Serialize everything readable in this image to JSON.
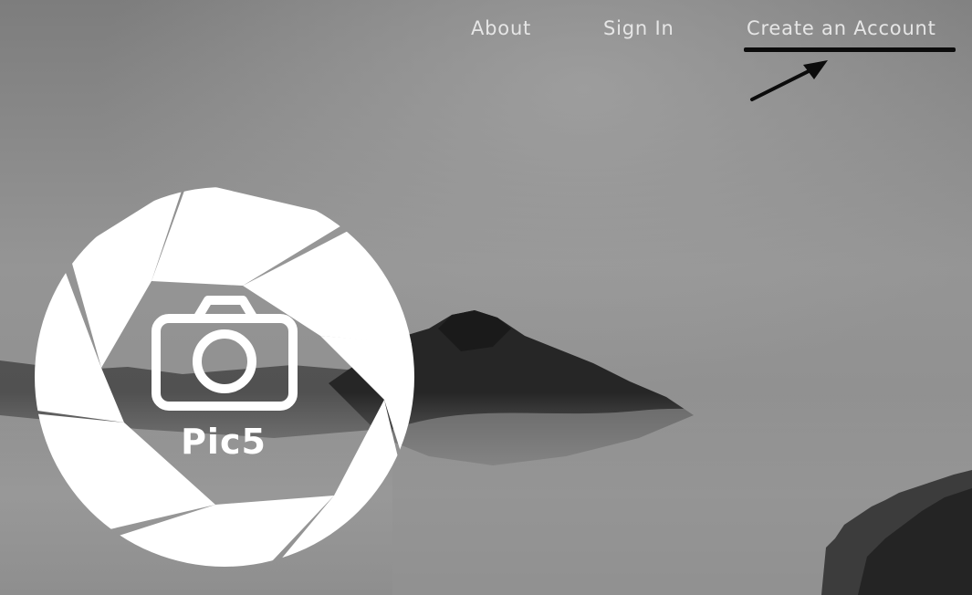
{
  "nav": {
    "about_label": "About",
    "signin_label": "Sign In",
    "create_label": "Create an Account"
  },
  "logo": {
    "brand_text": "Pic5"
  },
  "colors": {
    "nav_text": "#e6e6e6",
    "logo_fill": "#ffffff",
    "underline": "#0c0c0c",
    "background": "#8d8d8d"
  },
  "icons": {
    "logo": "aperture-camera-logo",
    "camera": "camera-icon",
    "annotation": "annotation-arrow-icon"
  }
}
